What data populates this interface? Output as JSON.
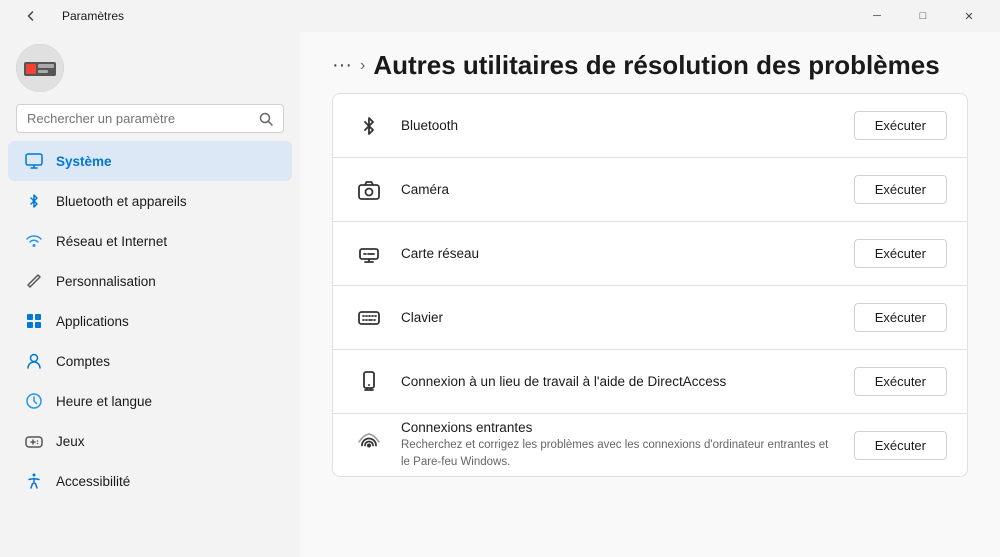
{
  "titlebar": {
    "title": "Paramètres",
    "back_icon": "←",
    "minimize_label": "─",
    "maximize_label": "□",
    "close_label": "✕"
  },
  "sidebar": {
    "search_placeholder": "Rechercher un paramètre",
    "search_icon": "🔍",
    "nav_items": [
      {
        "id": "systeme",
        "label": "Système",
        "icon": "💻",
        "active": true
      },
      {
        "id": "bluetooth",
        "label": "Bluetooth et appareils",
        "icon": "🔵",
        "active": false
      },
      {
        "id": "reseau",
        "label": "Réseau et Internet",
        "icon": "🌐",
        "active": false
      },
      {
        "id": "perso",
        "label": "Personnalisation",
        "icon": "✏️",
        "active": false
      },
      {
        "id": "applications",
        "label": "Applications",
        "icon": "📱",
        "active": false
      },
      {
        "id": "comptes",
        "label": "Comptes",
        "icon": "👤",
        "active": false
      },
      {
        "id": "heure",
        "label": "Heure et langue",
        "icon": "🌍",
        "active": false
      },
      {
        "id": "jeux",
        "label": "Jeux",
        "icon": "🎮",
        "active": false
      },
      {
        "id": "accessibilite",
        "label": "Accessibilité",
        "icon": "♿",
        "active": false
      }
    ]
  },
  "page": {
    "breadcrumb_dots": "···",
    "breadcrumb_chevron": "›",
    "title": "Autres utilitaires de résolution des problèmes",
    "run_label": "Exécuter",
    "items": [
      {
        "id": "bluetooth",
        "name": "Bluetooth",
        "description": "",
        "icon": "bluetooth"
      },
      {
        "id": "camera",
        "name": "Caméra",
        "description": "",
        "icon": "camera"
      },
      {
        "id": "carte-reseau",
        "name": "Carte réseau",
        "description": "",
        "icon": "network"
      },
      {
        "id": "clavier",
        "name": "Clavier",
        "description": "",
        "icon": "keyboard"
      },
      {
        "id": "connexion-travail",
        "name": "Connexion à un lieu de travail à l'aide de DirectAccess",
        "description": "",
        "icon": "phone"
      },
      {
        "id": "connexions-entrantes",
        "name": "Connexions entrantes",
        "description": "Recherchez et corrigez les problèmes avec les connexions d'ordinateur entrantes et le Pare-feu Windows.",
        "icon": "wifi"
      }
    ]
  }
}
